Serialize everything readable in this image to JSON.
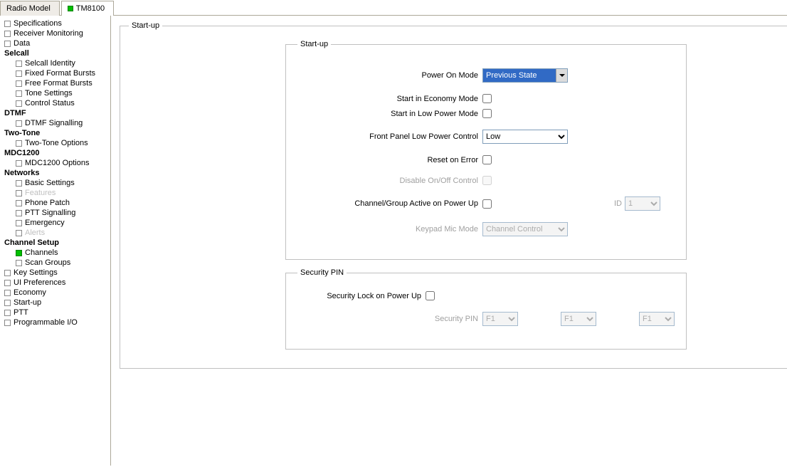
{
  "tabs": {
    "radio_model": "Radio Model",
    "device": "TM8100"
  },
  "sidebar": {
    "specifications": "Specifications",
    "receiver_monitoring": "Receiver Monitoring",
    "data": "Data",
    "selcall": "Selcall",
    "selcall_identity": "Selcall Identity",
    "fixed_format_bursts": "Fixed Format Bursts",
    "free_format_bursts": "Free Format Bursts",
    "tone_settings": "Tone Settings",
    "control_status": "Control Status",
    "dtmf": "DTMF",
    "dtmf_signalling": "DTMF Signalling",
    "two_tone": "Two-Tone",
    "two_tone_options": "Two-Tone Options",
    "mdc1200": "MDC1200",
    "mdc1200_options": "MDC1200 Options",
    "networks": "Networks",
    "basic_settings": "Basic Settings",
    "features": "Features",
    "phone_patch": "Phone Patch",
    "ptt_signalling": "PTT Signalling",
    "emergency": "Emergency",
    "alerts": "Alerts",
    "channel_setup": "Channel Setup",
    "channels": "Channels",
    "scan_groups": "Scan Groups",
    "key_settings": "Key Settings",
    "ui_preferences": "UI Preferences",
    "economy": "Economy",
    "start_up": "Start-up",
    "ptt": "PTT",
    "programmable_io": "Programmable I/O"
  },
  "page": {
    "title": "Start-up",
    "startup_group": "Start-up",
    "security_group": "Security PIN",
    "labels": {
      "power_on_mode": "Power On Mode",
      "start_economy": "Start in Economy Mode",
      "start_low_power": "Start in Low Power Mode",
      "front_panel_lpc": "Front Panel Low Power Control",
      "reset_on_error": "Reset on Error",
      "disable_onoff": "Disable On/Off Control",
      "chan_group_active": "Channel/Group Active on Power Up",
      "id": "ID",
      "keypad_mic_mode": "Keypad Mic Mode",
      "security_lock": "Security Lock on Power Up",
      "security_pin": "Security PIN"
    },
    "values": {
      "power_on_mode": "Previous State",
      "front_panel_lpc": "Low",
      "id": "1",
      "keypad_mic_mode": "Channel Control",
      "pin1": "F1",
      "pin2": "F1",
      "pin3": "F1"
    }
  }
}
